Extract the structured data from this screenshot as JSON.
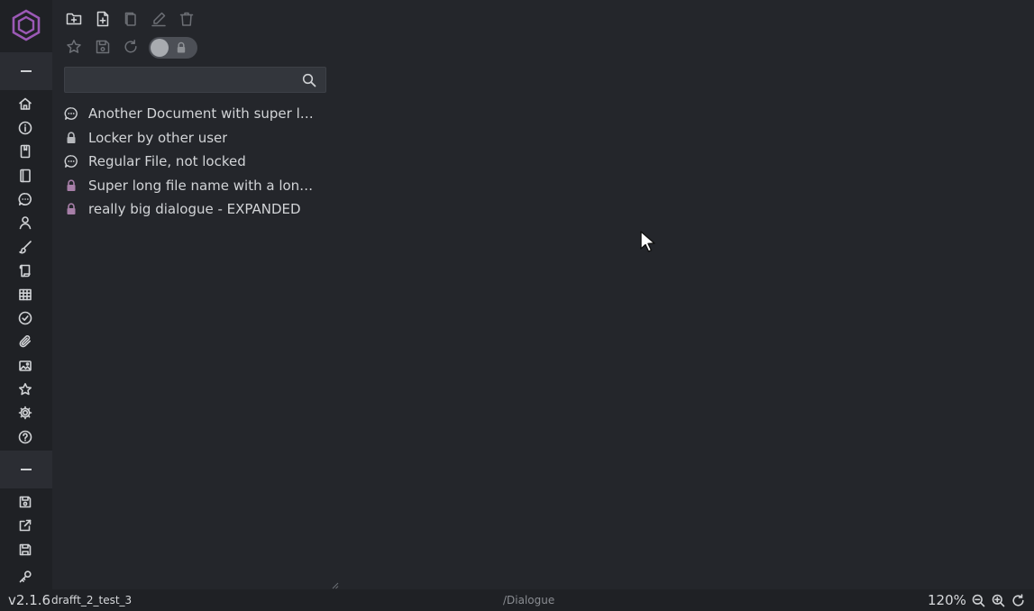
{
  "toolbar": {
    "row1": [
      "new-folder",
      "new-file",
      "copy",
      "rename",
      "delete"
    ],
    "row2": [
      "favorite",
      "save",
      "reload",
      "lock-toggle"
    ]
  },
  "search": {
    "value": "",
    "placeholder": ""
  },
  "files": [
    {
      "name": "Another Document with super long name",
      "display": "Another Document with super l…",
      "icon": "dialogue-icon",
      "locked": false
    },
    {
      "name": "Locker by other user",
      "display": "Locker by other user",
      "icon": "lock-icon",
      "locked": true,
      "lock_color": "#b6b8bc"
    },
    {
      "name": "Regular File, not locked",
      "display": "Regular File, not locked",
      "icon": "dialogue-icon",
      "locked": false
    },
    {
      "name": "Super long file name with a long name",
      "display": "Super long file name with a lon…",
      "icon": "lock-icon",
      "locked": true,
      "lock_color": "#a77fa8"
    },
    {
      "name": "really big dialogue - EXPANDED",
      "display": "really big dialogue - EXPANDED",
      "icon": "lock-icon",
      "locked": true,
      "lock_color": "#a77fa8"
    }
  ],
  "status": {
    "version": "v2.1.6",
    "project": "drafft_2_test_3",
    "path": "/Dialogue",
    "zoom": "120%"
  },
  "colors": {
    "background": "#24262b",
    "rail": "#1f2125",
    "accent": "#9b59b6"
  }
}
